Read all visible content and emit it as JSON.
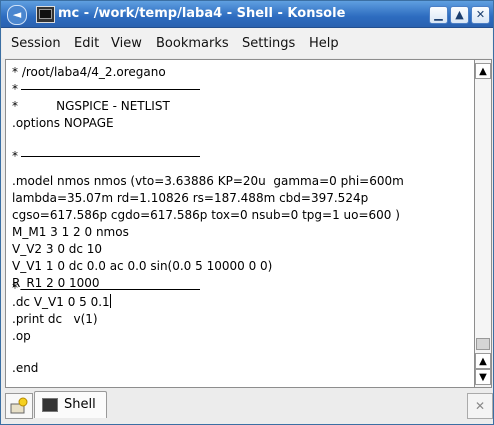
{
  "window": {
    "title": "mc - /work/temp/laba4 - Shell - Konsole",
    "menu_glyph": "◄",
    "minimize_glyph": "▁",
    "maximize_glyph": "▲",
    "close_glyph": "✕"
  },
  "menubar": {
    "items": [
      "Session",
      "Edit",
      "View",
      "Bookmarks",
      "Settings",
      "Help"
    ]
  },
  "terminal": {
    "lines": [
      "* /root/laba4/4_2.oregano",
      "*",
      "*          NGSPICE - NETLIST",
      ".options NOPAGE",
      "*",
      ".model nmos nmos (vto=3.63886 KP=20u  gamma=0 phi=600m",
      "lambda=35.07m rd=1.10826 rs=187.488m cbd=397.524p",
      "cgso=617.586p cgdo=617.586p tox=0 nsub=0 tpg=1 uo=600 )",
      "M_M1 3 1 2 0 nmos",
      "V_V2 3 0 dc 10",
      "V_V1 1 0 dc 0.0 ac 0.0 sin(0.0 5 10000 0 0)",
      "R_R1 2 0 1000",
      "*",
      ".dc V_V1 0 5 0.1",
      ".print dc   v(1)",
      ".op",
      ".end"
    ]
  },
  "scrollbar": {
    "up_glyph": "▲",
    "down_glyph": "▼",
    "position": 0.85
  },
  "tabbar": {
    "tabs": [
      {
        "label": "Shell"
      }
    ],
    "close_glyph": "✕"
  }
}
